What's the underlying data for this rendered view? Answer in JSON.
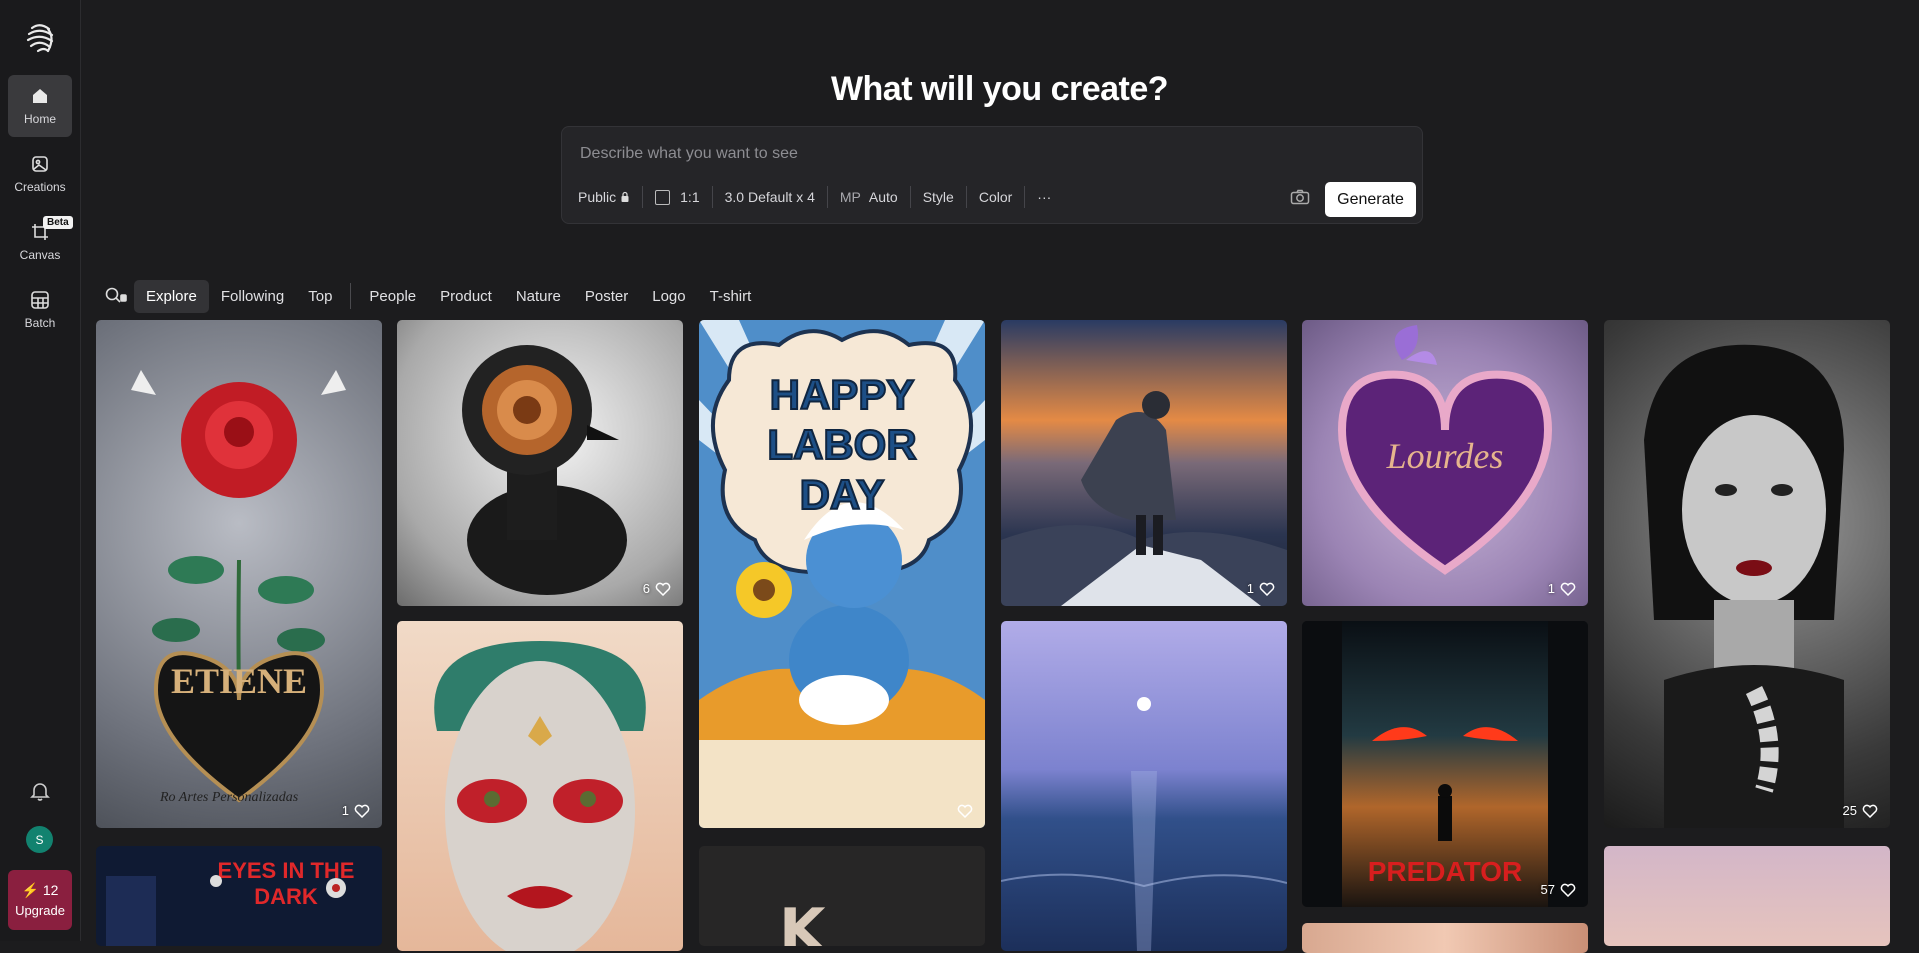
{
  "sidebar": {
    "items": [
      {
        "label": "Home",
        "icon": "home-icon"
      },
      {
        "label": "Creations",
        "icon": "image-icon"
      },
      {
        "label": "Canvas",
        "icon": "canvas-icon",
        "badge": "Beta"
      },
      {
        "label": "Batch",
        "icon": "grid-icon"
      }
    ],
    "avatar_initial": "S",
    "upgrade": {
      "credits": "12",
      "label": "Upgrade"
    }
  },
  "hero": {
    "title": "What will you create?",
    "placeholder": "Describe what you want to see",
    "toolbar": {
      "visibility": "Public",
      "ratio": "1:1",
      "model": "3.0 Default x 4",
      "mp_label": "MP",
      "mp_value": "Auto",
      "style": "Style",
      "color": "Color",
      "more": "···"
    },
    "generate_label": "Generate"
  },
  "filters": [
    "Explore",
    "Following",
    "Top",
    "People",
    "Product",
    "Nature",
    "Poster",
    "Logo",
    "T-shirt"
  ],
  "gallery": [
    {
      "name": "rose-heart-etiene",
      "text": "ETIENE",
      "caption": "Ro Artes Personalizadas",
      "likes": "1"
    },
    {
      "name": "xray-bird",
      "likes": "6"
    },
    {
      "name": "labor-day-smurf",
      "text": "HAPPY LABOR DAY",
      "likes": ""
    },
    {
      "name": "mountain-sunset",
      "likes": "1"
    },
    {
      "name": "purple-heart-lourdes",
      "text": "Lourdes",
      "likes": "1"
    },
    {
      "name": "bw-portrait-woman",
      "likes": "25"
    },
    {
      "name": "eyes-in-the-dark",
      "text": "EYES IN THE DARK"
    },
    {
      "name": "joker-face"
    },
    {
      "name": "dark-logo",
      "text": "K"
    },
    {
      "name": "moonlit-sea"
    },
    {
      "name": "predator-forest",
      "text": "PREDATOR",
      "likes": "57"
    },
    {
      "name": "peach-sky"
    },
    {
      "name": "peach-skin"
    }
  ],
  "colors": {
    "accent": "#8a1f3f",
    "avatar": "#12826f",
    "bg": "#1c1c1e"
  }
}
